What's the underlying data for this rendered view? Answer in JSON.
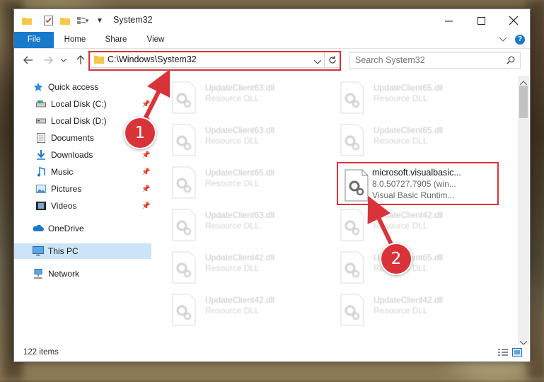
{
  "window": {
    "title": "System32"
  },
  "ribbon": {
    "tabs": [
      "File",
      "Home",
      "Share",
      "View"
    ]
  },
  "address": {
    "path": "C:\\Windows\\System32"
  },
  "search": {
    "placeholder": "Search System32"
  },
  "nav": {
    "items": [
      {
        "label": "Quick access",
        "icon": "star-icon"
      },
      {
        "label": "Local Disk (C:)",
        "icon": "drive-icon",
        "pinned": true
      },
      {
        "label": "Local Disk (D:)",
        "icon": "drive-icon",
        "pinned": true
      },
      {
        "label": "Documents",
        "icon": "documents-icon",
        "pinned": true
      },
      {
        "label": "Downloads",
        "icon": "downloads-icon",
        "pinned": true
      },
      {
        "label": "Music",
        "icon": "music-icon",
        "pinned": true
      },
      {
        "label": "Pictures",
        "icon": "pictures-icon",
        "pinned": true
      },
      {
        "label": "Videos",
        "icon": "videos-icon",
        "pinned": true
      },
      {
        "label": "OneDrive",
        "icon": "cloud-icon"
      },
      {
        "label": "This PC",
        "icon": "computer-icon",
        "selected": true
      },
      {
        "label": "Network",
        "icon": "network-icon"
      }
    ]
  },
  "files": [
    {
      "name": "UpdateClient63.dll",
      "type": "Resource DLL"
    },
    {
      "name": "UpdateClient65.dll",
      "type": "Resource DLL"
    },
    {
      "name": "UpdateClient63.dll",
      "type": "Resource DLL"
    },
    {
      "name": "UpdateClient65.dll",
      "type": "Resource DLL"
    },
    {
      "name": "UpdateClient65.dll",
      "type": "Resource DLL"
    },
    {
      "name": "microsoft.visualbasic...",
      "version": "8.0.50727.7905 (win...",
      "type": "Visual Basic Runtim...",
      "highlighted": true
    },
    {
      "name": "UpdateClient63.dll",
      "type": "Resource DLL"
    },
    {
      "name": "UpdateClient42.dll",
      "type": "Resource DLL"
    },
    {
      "name": "UpdateClient42.dll",
      "type": "Resource DLL"
    },
    {
      "name": "UpdateClient65.dll",
      "type": "Resource DLL"
    },
    {
      "name": "UpdateClient42.dll",
      "type": "Resource DLL"
    },
    {
      "name": "UpdateClient42.dll",
      "type": "Resource DLL"
    }
  ],
  "status": {
    "count": "122 items"
  },
  "annotations": {
    "badge1": "1",
    "badge2": "2"
  },
  "colors": {
    "accent": "#1979ca",
    "annotation": "#d9333a",
    "selection": "#cce4f7"
  }
}
